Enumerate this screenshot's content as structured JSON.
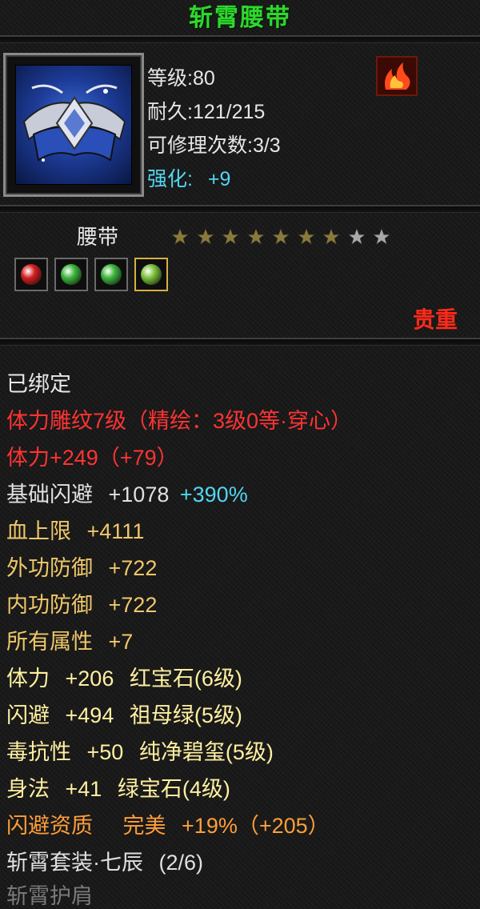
{
  "item": {
    "name": "斩霄腰带",
    "level_label": "等级:80",
    "durability_label": "耐久:121/215",
    "repair_label": "可修理次数:3/3",
    "enhance_label": "强化:",
    "enhance_value": "+9",
    "type": "腰带",
    "stars_filled": 7,
    "stars_total": 9,
    "rarity": "贵重",
    "icon": "belt-icon",
    "badge_icon": "flame-icon"
  },
  "gems": [
    {
      "name": "red-gem-icon",
      "color": "#d42020"
    },
    {
      "name": "green-gem-icon",
      "color": "#3db63d"
    },
    {
      "name": "green-gem-icon",
      "color": "#3db63d"
    },
    {
      "name": "jade-gem-icon",
      "color": "#7ac23a"
    }
  ],
  "attributes": {
    "bound": "已绑定",
    "engrave": "体力雕纹7级（精绘：3级0等·穿心）",
    "vitality": "体力+249（+79）",
    "dodge_base_label": "基础闪避",
    "dodge_base_value": "+1078",
    "dodge_base_pct": "+390%",
    "hp_label": "血上限",
    "hp_value": "+4111",
    "outer_def_label": "外功防御",
    "outer_def_value": "+722",
    "inner_def_label": "内功防御",
    "inner_def_value": "+722",
    "all_attr_label": "所有属性",
    "all_attr_value": "+7",
    "gem1_stat": "体力",
    "gem1_value": "+206",
    "gem1_name": "红宝石(6级)",
    "gem2_stat": "闪避",
    "gem2_value": "+494",
    "gem2_name": "祖母绿(5级)",
    "gem3_stat": "毒抗性",
    "gem3_value": "+50",
    "gem3_name": "纯净碧玺(5级)",
    "gem4_stat": "身法",
    "gem4_value": "+41",
    "gem4_name": "绿宝石(4级)",
    "quality_label": "闪避资质",
    "quality_grade": "完美",
    "quality_value": "+19%（+205）",
    "set_name": "斩霄套装·七辰",
    "set_count": "(2/6)",
    "set_piece": "斩霄护肩"
  },
  "colors": {
    "title": "#2fd62f",
    "rarity": "#ff2a1a",
    "engrave": "#ff3333",
    "enhance": "#52d6f0",
    "gem_attr": "#fff0a0",
    "quality": "#ff9f3a"
  }
}
